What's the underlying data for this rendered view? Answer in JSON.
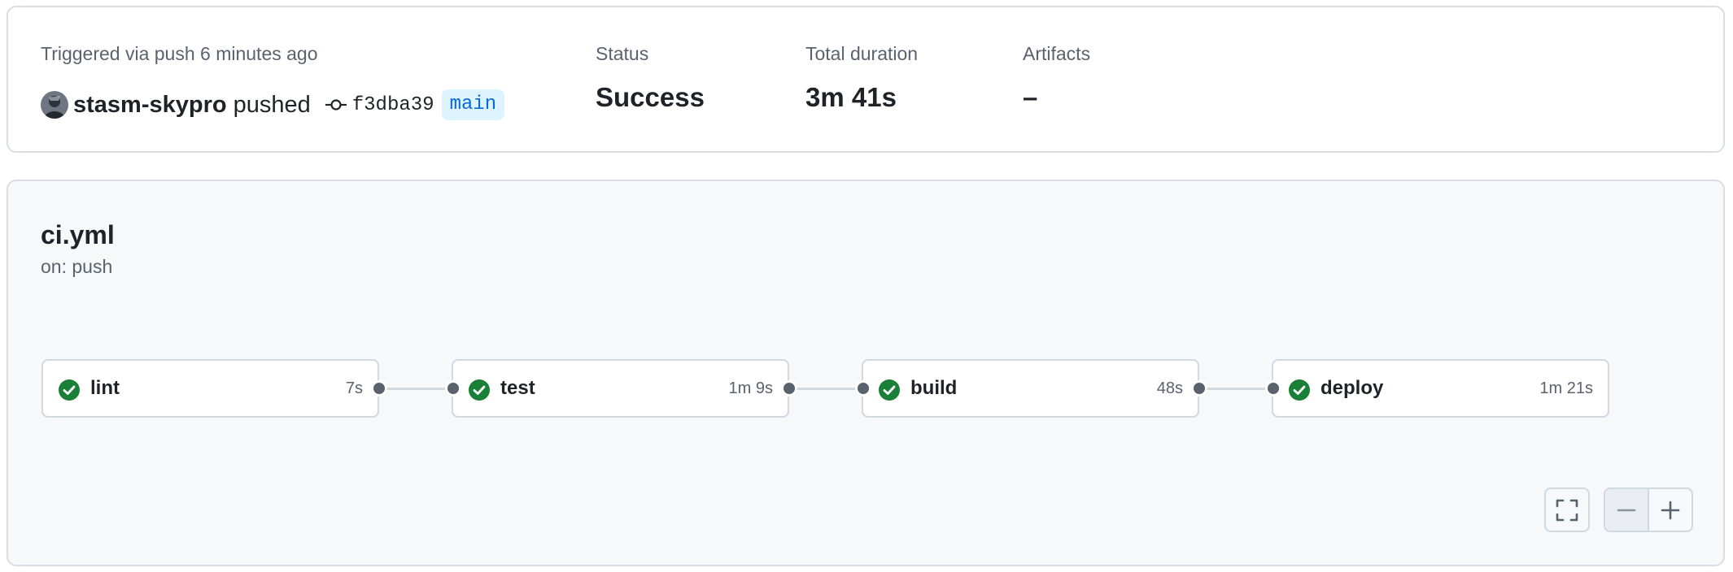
{
  "summary": {
    "trigger_text": "Triggered via push 6 minutes ago",
    "actor": "stasm-skypro",
    "action": "pushed",
    "commit_sha": "f3dba39",
    "branch": "main",
    "status_label": "Status",
    "status_value": "Success",
    "duration_label": "Total duration",
    "duration_value": "3m 41s",
    "artifacts_label": "Artifacts",
    "artifacts_value": "–"
  },
  "workflow": {
    "file": "ci.yml",
    "trigger": "on: push",
    "jobs": [
      {
        "name": "lint",
        "duration": "7s",
        "status": "success"
      },
      {
        "name": "test",
        "duration": "1m 9s",
        "status": "success"
      },
      {
        "name": "build",
        "duration": "48s",
        "status": "success"
      },
      {
        "name": "deploy",
        "duration": "1m 21s",
        "status": "success"
      }
    ]
  },
  "controls": {
    "fullscreen_icon": "fullscreen-icon",
    "zoom_out_icon": "minus-icon",
    "zoom_in_icon": "plus-icon"
  },
  "colors": {
    "success": "#1a7f37",
    "branch_bg": "#ddf4ff",
    "branch_fg": "#0969da",
    "graph_bg": "#f6f8fa",
    "muted_text": "#59636e"
  }
}
